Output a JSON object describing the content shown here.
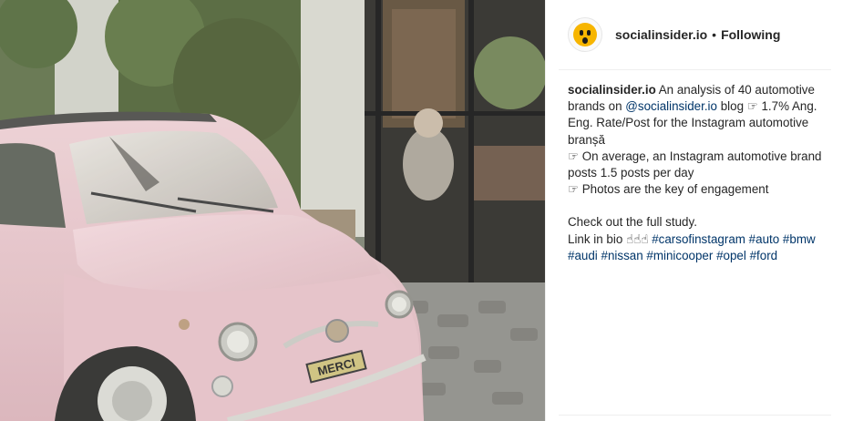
{
  "post": {
    "author": "socialinsider.io",
    "separator": "•",
    "follow_status": "Following",
    "caption": {
      "author": "socialinsider.io",
      "intro": "An analysis of 40 automotive brands on",
      "mention": "@socialinsider.io",
      "line1_rest": "blog ☞ 1.7% Ang. Eng. Rate/Post for the Instagram automotive branșă",
      "line2": "☞ On average, an Instagram automotive brand posts 1.5 posts per day",
      "line3": "☞ Photos are the key of engagement",
      "cta": "Check out the full study.",
      "link_in_bio": "Link in bio ☝☝☝",
      "hashtags": [
        "#carsofinstagram",
        "#auto",
        "#bmw",
        "#audi",
        "#nissan",
        "#minicooper",
        "#opel",
        "#ford"
      ]
    },
    "photo": {
      "plate_text": "MERCI",
      "car_color": "#e8c6cc"
    }
  }
}
